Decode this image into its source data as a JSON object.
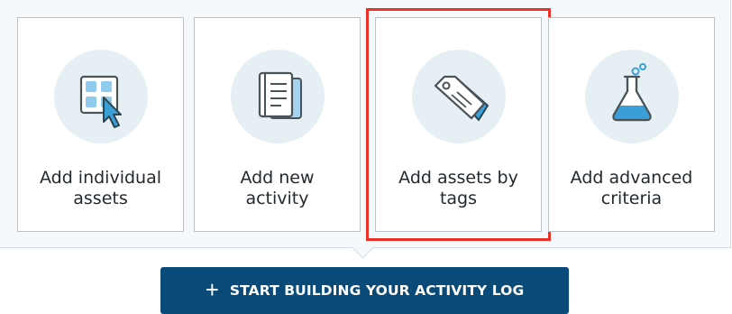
{
  "cards": [
    {
      "label_line1": "Add individual",
      "label_line2": "assets",
      "icon": "grid-cursor-icon",
      "selected": false
    },
    {
      "label_line1": "Add new",
      "label_line2": "activity",
      "icon": "notebook-icon",
      "selected": false
    },
    {
      "label_line1": "Add assets by",
      "label_line2": "tags",
      "icon": "tags-icon",
      "selected": true
    },
    {
      "label_line1": "Add advanced",
      "label_line2": "criteria",
      "icon": "flask-icon",
      "selected": false
    }
  ],
  "start_button": {
    "icon": "plus-icon",
    "plus_glyph": "+",
    "label": "START BUILDING YOUR ACTIVITY LOG"
  },
  "colors": {
    "accent": "#0a4a78",
    "icon_blue": "#3a9fd6",
    "icon_circle": "#e6f0f4",
    "highlight": "#e8322a"
  }
}
